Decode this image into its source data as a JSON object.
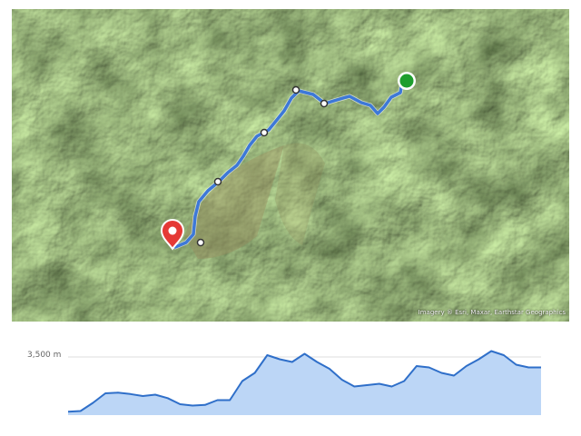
{
  "map": {
    "imagery_attribution": "Imagery ® Esri, Maxar, Earthstar Geographics",
    "route_color": "#3d78d8",
    "start_marker_color": "#1e9e2e",
    "end_marker_color": "#e53935"
  },
  "elevation_profile": {
    "gridline_label": "3,500 m",
    "line_color": "#2f6fc9",
    "fill_color": "#bcd6f6"
  },
  "chart_data": {
    "type": "area",
    "ylabel_tick": "3,500 m",
    "samples": [
      0.05,
      0.06,
      0.18,
      0.32,
      0.33,
      0.31,
      0.28,
      0.3,
      0.25,
      0.16,
      0.14,
      0.15,
      0.22,
      0.22,
      0.5,
      0.62,
      0.88,
      0.82,
      0.78,
      0.9,
      0.78,
      0.68,
      0.52,
      0.42,
      0.44,
      0.46,
      0.42,
      0.5,
      0.72,
      0.7,
      0.62,
      0.58,
      0.72,
      0.82,
      0.94,
      0.88,
      0.74,
      0.7,
      0.7
    ]
  }
}
